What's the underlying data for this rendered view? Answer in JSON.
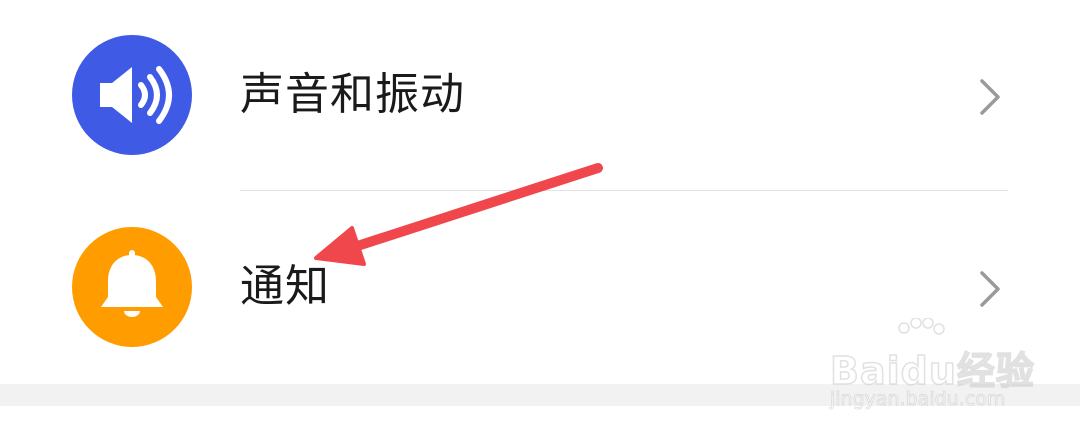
{
  "settings": {
    "items": [
      {
        "label": "声音和振动",
        "icon": "speaker-icon",
        "icon_color": "#3f5ae5"
      },
      {
        "label": "通知",
        "icon": "bell-icon",
        "icon_color": "#ff9c00"
      }
    ],
    "chevron_icon": "chevron-right-icon",
    "chevron_color": "#9a9a9a"
  },
  "annotation": {
    "arrow_color": "#f0474d"
  },
  "watermark": {
    "logo": "Baidu经验",
    "url": "jingyan.baidu.com"
  }
}
